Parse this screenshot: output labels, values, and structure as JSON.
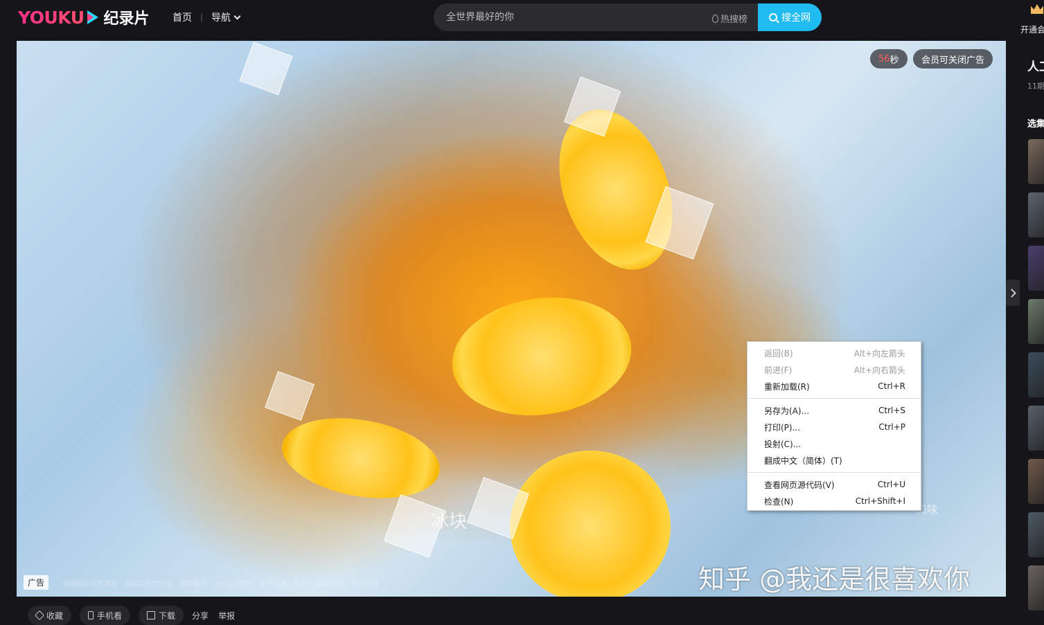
{
  "header": {
    "logo_text": "YOUKU",
    "channel": "纪录片",
    "nav": {
      "home": "首页",
      "separator": "|",
      "guide": "导航"
    },
    "search": {
      "placeholder": "全世界最好的你",
      "hot_label": "热搜榜",
      "button_label": "搜全网"
    },
    "vip_label": "开通会"
  },
  "player": {
    "ad_countdown": "56",
    "ad_countdown_unit": "秒",
    "ad_close_label": "会员可关闭广告",
    "ad_tag": "广告",
    "subtitle_left": "冰块",
    "subtitle_right": "口味",
    "disclaimer": "海报图片仅供参考  ·  具体以实物为准  ·  请勿模仿  ·  @2020版权  ·  本产品由…生产  ·  (20XX)号  ·  咨询热线"
  },
  "context_menu": {
    "groups": [
      [
        {
          "label": "返回(B)",
          "shortcut": "Alt+向左箭头",
          "disabled": true
        },
        {
          "label": "前进(F)",
          "shortcut": "Alt+向右箭头",
          "disabled": true
        },
        {
          "label": "重新加载(R)",
          "shortcut": "Ctrl+R",
          "disabled": false
        }
      ],
      [
        {
          "label": "另存为(A)...",
          "shortcut": "Ctrl+S",
          "disabled": false
        },
        {
          "label": "打印(P)...",
          "shortcut": "Ctrl+P",
          "disabled": false
        },
        {
          "label": "投射(C)...",
          "shortcut": "",
          "disabled": false
        },
        {
          "label": "翻成中文（简体）(T)",
          "shortcut": "",
          "disabled": false
        }
      ],
      [
        {
          "label": "查看网页源代码(V)",
          "shortcut": "Ctrl+U",
          "disabled": false
        },
        {
          "label": "检查(N)",
          "shortcut": "Ctrl+Shift+I",
          "disabled": false
        }
      ]
    ]
  },
  "watermark": "知乎 @我还是很喜欢你",
  "sidebar": {
    "title": "人工",
    "subtitle": "11期",
    "select_label": "选集",
    "thumb_colors": [
      "#7a6a5c",
      "#5d6470",
      "#4a3f6e",
      "#6b7b6a",
      "#3c4d5e",
      "#58606a",
      "#705a4a",
      "#4e5a66",
      "#6a6460"
    ]
  },
  "actions": {
    "favorite": "收藏",
    "mobile": "手机看",
    "download": "下载",
    "share": "分享",
    "report": "举报"
  },
  "colors": {
    "accent": "#1ebcf0",
    "background": "#16161a",
    "countdown": "#ff5c5c"
  }
}
